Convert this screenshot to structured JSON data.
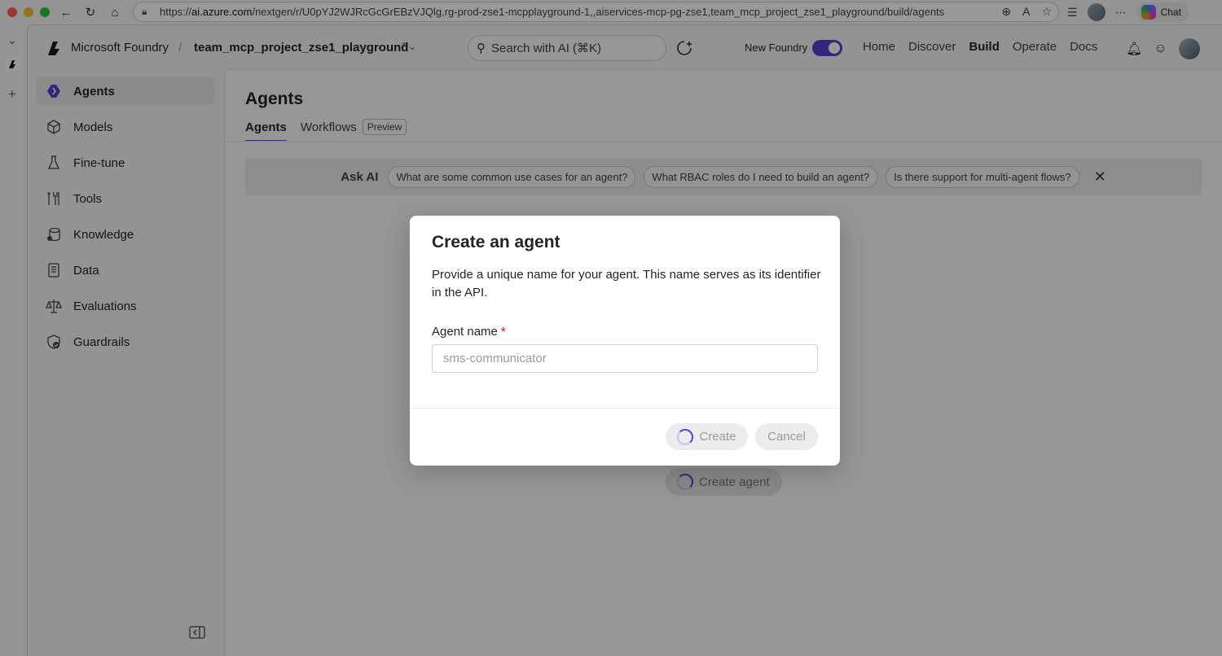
{
  "browser": {
    "url_prefix": "https://",
    "url_host": "ai.azure.com",
    "url_path": "/nextgen/r/U0pYJ2WJRcGcGrEBzVJQlg,rg-prod-zse1-mcpplayground-1,,aiservices-mcp-pg-zse1,team_mcp_project_zse1_playground/build/agents",
    "chat_label": "Chat"
  },
  "header": {
    "brand": "Microsoft Foundry",
    "separator": "/",
    "project": "team_mcp_project_zse1_playground",
    "search_placeholder": "Search with AI (⌘K)",
    "new_foundry_label": "New Foundry",
    "new_foundry_on": true,
    "nav": [
      "Home",
      "Discover",
      "Build",
      "Operate",
      "Docs"
    ],
    "active_nav": "Build"
  },
  "sidebar": {
    "items": [
      {
        "label": "Agents",
        "icon": "agents-icon",
        "active": true
      },
      {
        "label": "Models",
        "icon": "models-icon",
        "active": false
      },
      {
        "label": "Fine-tune",
        "icon": "fine-tune-icon",
        "active": false
      },
      {
        "label": "Tools",
        "icon": "tools-icon",
        "active": false
      },
      {
        "label": "Knowledge",
        "icon": "knowledge-icon",
        "active": false
      },
      {
        "label": "Data",
        "icon": "data-icon",
        "active": false
      },
      {
        "label": "Evaluations",
        "icon": "evaluations-icon",
        "active": false
      },
      {
        "label": "Guardrails",
        "icon": "guardrails-icon",
        "active": false
      }
    ]
  },
  "main": {
    "title": "Agents",
    "tabs": [
      {
        "label": "Agents",
        "active": true
      },
      {
        "label": "Workflows",
        "active": false
      }
    ],
    "preview_badge": "Preview",
    "ask_ai": {
      "label": "Ask AI",
      "suggestions": [
        "What are some common use cases for an agent?",
        "What RBAC roles do I need to build an agent?",
        "Is there support for multi-agent flows?"
      ]
    },
    "create_agent_label": "Create agent"
  },
  "dialog": {
    "title": "Create an agent",
    "description": "Provide a unique name for your agent. This name serves as its identifier in the API.",
    "field_label": "Agent name",
    "required_mark": "*",
    "input_value": "",
    "input_placeholder": "sms-communicator",
    "create_label": "Create",
    "cancel_label": "Cancel"
  },
  "colors": {
    "accent": "#5b3fd1",
    "required": "#c50f1f"
  }
}
